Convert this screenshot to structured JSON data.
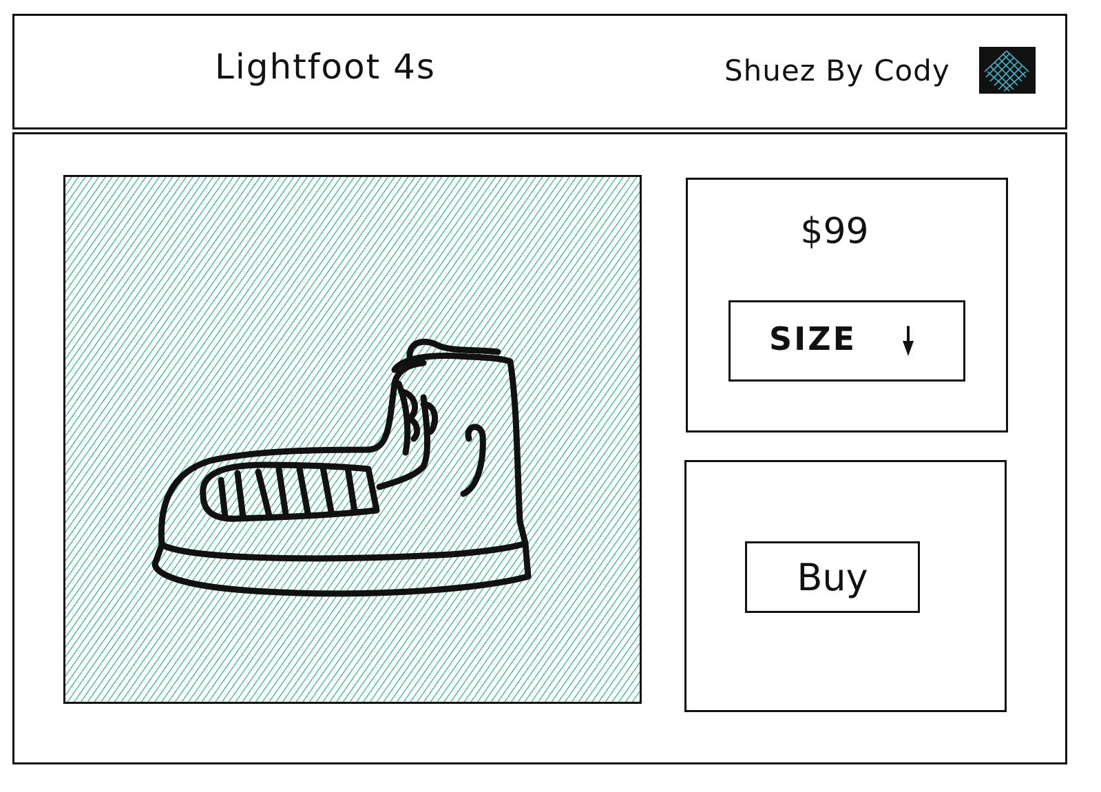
{
  "header": {
    "product_title": "Lightfoot 4s",
    "brand": "Shuez By Cody",
    "logo_icon": "crosshatch-logo-icon"
  },
  "product": {
    "image_icon": "high-top-sneaker-illustration",
    "image_fill_color": "#3bb892",
    "price": "$99",
    "size_select": {
      "label": "SIZE",
      "icon": "down-arrow-icon"
    },
    "buy_label": "Buy"
  }
}
